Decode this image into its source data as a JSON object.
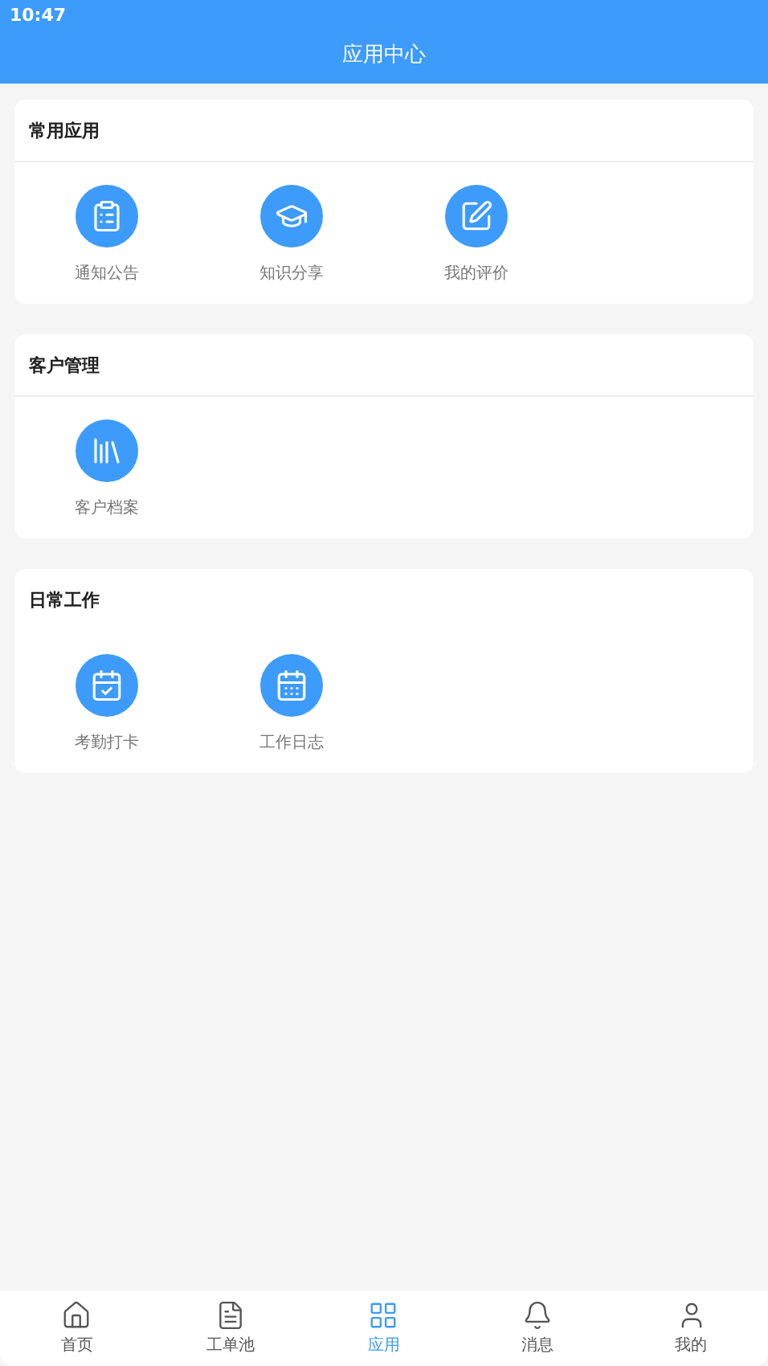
{
  "status_bar": {
    "time": "10:47"
  },
  "header": {
    "title": "应用中心"
  },
  "sections": [
    {
      "title": "常用应用",
      "divider": true,
      "apps": [
        {
          "label": "通知公告"
        },
        {
          "label": "知识分享"
        },
        {
          "label": "我的评价"
        }
      ]
    },
    {
      "title": "客户管理",
      "divider": true,
      "apps": [
        {
          "label": "客户档案"
        }
      ]
    },
    {
      "title": "日常工作",
      "divider": false,
      "apps": [
        {
          "label": "考勤打卡"
        },
        {
          "label": "工作日志"
        }
      ]
    }
  ],
  "tab_bar": [
    {
      "label": "首页",
      "selected": false
    },
    {
      "label": "工单池",
      "selected": false
    },
    {
      "label": "应用",
      "selected": true
    },
    {
      "label": "消息",
      "selected": false
    },
    {
      "label": "我的",
      "selected": false
    }
  ]
}
